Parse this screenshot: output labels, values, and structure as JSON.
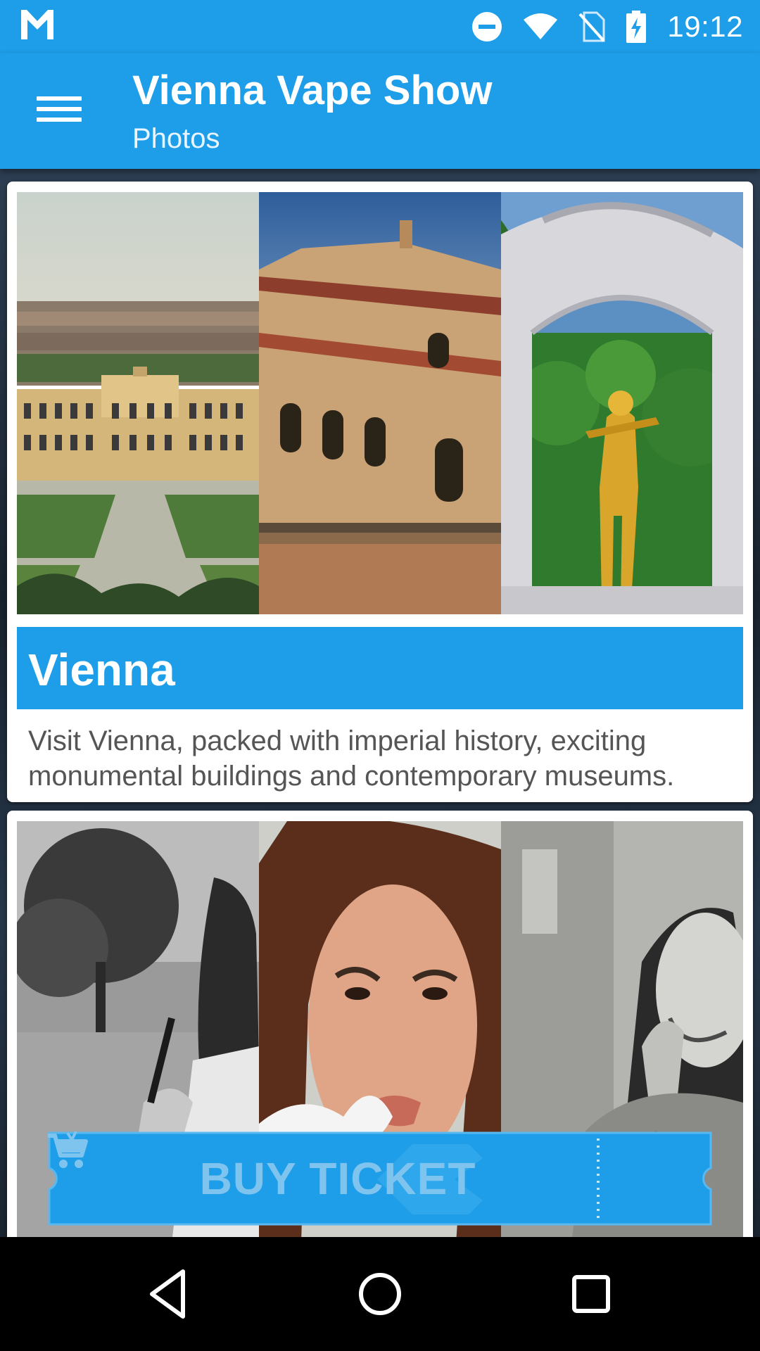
{
  "status_bar": {
    "time": "19:12",
    "icons": [
      "gmail-icon",
      "do-not-disturb-icon",
      "wifi-icon",
      "no-sim-icon",
      "battery-charging-icon"
    ]
  },
  "app_bar": {
    "title": "Vienna Vape Show",
    "subtitle": "Photos",
    "menu_icon": "hamburger-menu-icon",
    "color": "#1e9ee8"
  },
  "cards": [
    {
      "title": "Vienna",
      "description": "Visit Vienna, packed with imperial history, exciting monumental buildings and contemporary museums.",
      "photos": [
        "palace-photo",
        "opera-building-photo",
        "golden-statue-photo"
      ]
    },
    {
      "photos": [
        "man-vaping-photo",
        "woman-vaping-photo",
        "woman-phone-photo"
      ]
    }
  ],
  "ticket_button": {
    "label": "BUY TICKET",
    "icon": "shopping-cart-icon"
  },
  "nav_bar": {
    "buttons": [
      "back-icon",
      "home-icon",
      "recent-apps-icon"
    ]
  }
}
